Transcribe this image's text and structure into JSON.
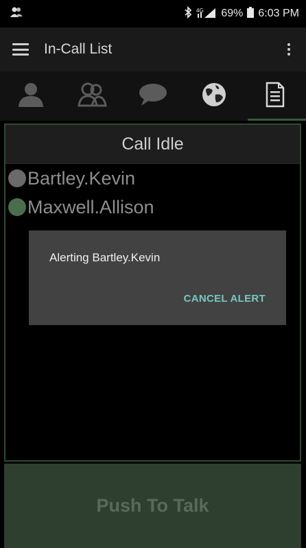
{
  "status_bar": {
    "battery": "69%",
    "time": "6:03 PM",
    "icons": [
      "contacts-notification-icon",
      "bluetooth-icon",
      "lte-signal-icon",
      "battery-icon"
    ]
  },
  "app_bar": {
    "title": "In-Call List",
    "icons": [
      "menu-icon",
      "overflow-menu-icon"
    ]
  },
  "tabs": [
    {
      "icon": "contact-icon",
      "active": false
    },
    {
      "icon": "group-icon",
      "active": false
    },
    {
      "icon": "chat-icon",
      "active": false
    },
    {
      "icon": "globe-icon",
      "active": false
    },
    {
      "icon": "document-list-icon",
      "active": true
    }
  ],
  "call": {
    "status": "Call Idle",
    "members": [
      {
        "name": "Bartley.Kevin",
        "status_color": "#6a6a6a"
      },
      {
        "name": "Maxwell.Allison",
        "status_color": "#4a6e4c"
      }
    ]
  },
  "dialog": {
    "message_prefix": "Alerting ",
    "message_name": "Bartley.Kevin",
    "cancel_label": "CANCEL ALERT"
  },
  "push_to_talk": {
    "label": "Push To Talk"
  },
  "colors": {
    "accent_green": "#3a5a3e",
    "dialog_button": "#76c8c0",
    "ptt_background": "#2f3f2f"
  }
}
